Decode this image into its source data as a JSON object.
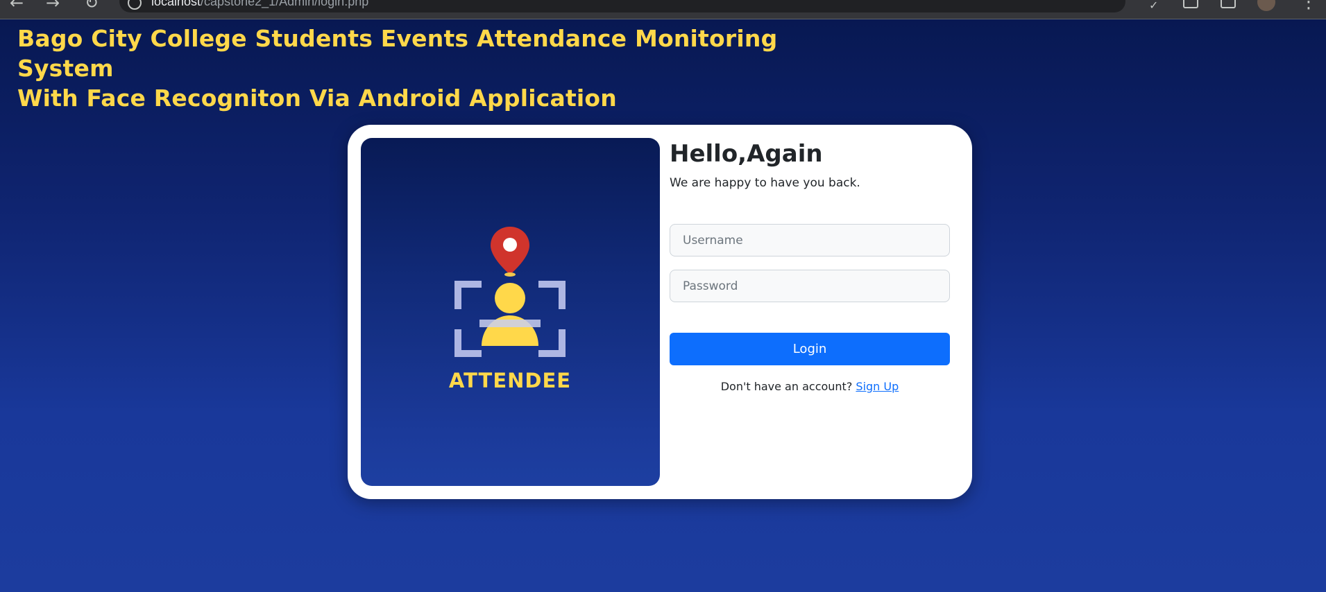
{
  "browser": {
    "url_host": "localhost",
    "url_path": "/capstone2_1/Admin/login.php"
  },
  "header": {
    "title_line1": "Bago City College Students Events Attendance Monitoring System",
    "title_line2": "With Face Recogniton Via Android Application"
  },
  "hero": {
    "logo_text": "ATTENDEE",
    "icons": [
      "map-pin-icon",
      "face-scan-frame-icon",
      "person-icon"
    ]
  },
  "login": {
    "heading": "Hello,Again",
    "subheading": "We are happy to have you back.",
    "username_placeholder": "Username",
    "password_placeholder": "Password",
    "login_label": "Login",
    "signup_prompt": "Don't have an account?",
    "signup_label": "Sign Up"
  },
  "colors": {
    "title_yellow": "#ffd84a",
    "primary_button": "#0d6efd",
    "background_top": "#07174f",
    "background_bottom": "#1c3c9e"
  }
}
